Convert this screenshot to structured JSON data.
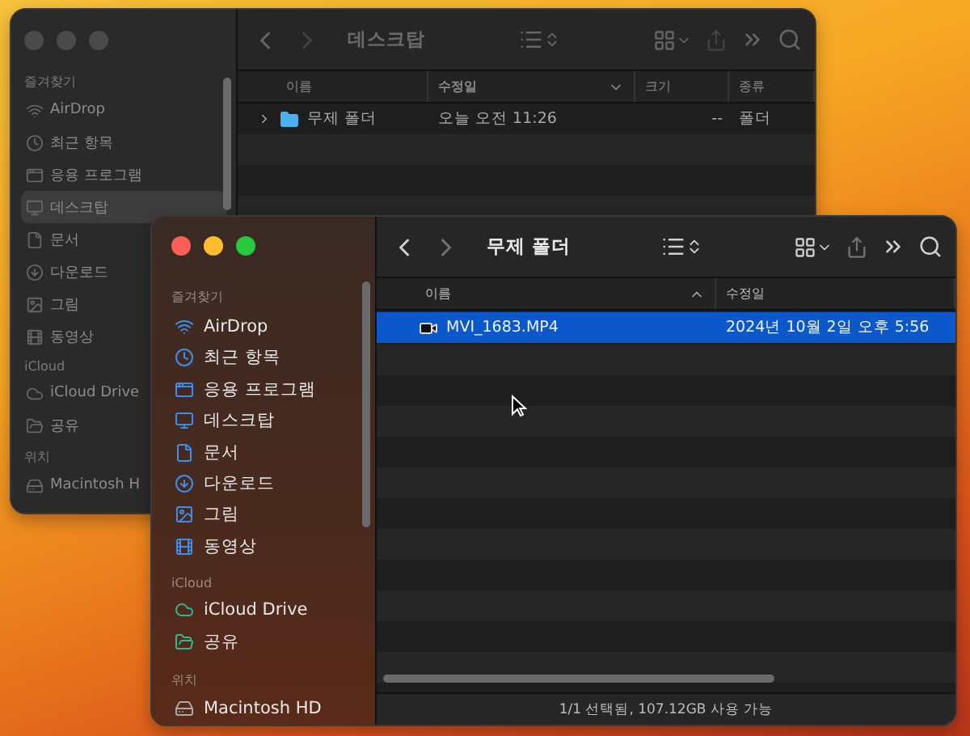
{
  "windows": [
    {
      "active": false,
      "title": "데스크탑",
      "sidebar": [
        {
          "heading": "즐겨찾기",
          "items": [
            {
              "label": "AirDrop",
              "selected": false
            },
            {
              "label": "최근 항목",
              "selected": false
            },
            {
              "label": "응용 프로그램",
              "selected": false
            },
            {
              "label": "데스크탑",
              "selected": true
            },
            {
              "label": "문서",
              "selected": false
            },
            {
              "label": "다운로드",
              "selected": false
            },
            {
              "label": "그림",
              "selected": false
            },
            {
              "label": "동영상",
              "selected": false
            }
          ]
        },
        {
          "heading": "iCloud",
          "items": [
            {
              "label": "iCloud Drive",
              "selected": false
            },
            {
              "label": "공유",
              "selected": false
            }
          ]
        },
        {
          "heading": "위치",
          "items": [
            {
              "label": "Macintosh H",
              "selected": false
            }
          ]
        }
      ],
      "columns": [
        {
          "label": "이름",
          "sorted": false
        },
        {
          "label": "수정일",
          "sorted": true,
          "ascending": false
        },
        {
          "label": "크기",
          "sorted": false
        },
        {
          "label": "종류",
          "sorted": false
        }
      ],
      "rows": [
        {
          "kind": "folder",
          "expandable": true,
          "selected": false,
          "cells": [
            "무제 폴더",
            "오늘 오전 11:26",
            "--",
            "폴더"
          ]
        }
      ]
    },
    {
      "active": true,
      "title": "무제 폴더",
      "sidebar": [
        {
          "heading": "즐겨찾기",
          "items": [
            {
              "label": "AirDrop",
              "selected": false
            },
            {
              "label": "최근 항목",
              "selected": false
            },
            {
              "label": "응용 프로그램",
              "selected": false
            },
            {
              "label": "데스크탑",
              "selected": false
            },
            {
              "label": "문서",
              "selected": false
            },
            {
              "label": "다운로드",
              "selected": false
            },
            {
              "label": "그림",
              "selected": false
            },
            {
              "label": "동영상",
              "selected": false
            }
          ]
        },
        {
          "heading": "iCloud",
          "items": [
            {
              "label": "iCloud Drive",
              "selected": false
            },
            {
              "label": "공유",
              "selected": false
            }
          ]
        },
        {
          "heading": "위치",
          "items": [
            {
              "label": "Macintosh HD",
              "selected": false
            }
          ]
        }
      ],
      "columns": [
        {
          "label": "이름",
          "sorted": true,
          "ascending": true
        },
        {
          "label": "수정일",
          "sorted": false
        }
      ],
      "rows": [
        {
          "kind": "video",
          "expandable": false,
          "selected": true,
          "cells": [
            "MVI_1683.MP4",
            "2024년 10월 2일 오후 5:56"
          ]
        }
      ],
      "status": "1/1 선택됨, 107.12GB 사용 가능"
    }
  ]
}
